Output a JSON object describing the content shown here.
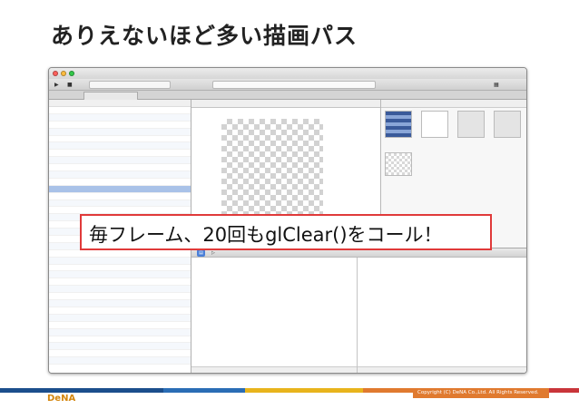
{
  "slide": {
    "title": "ありえないほど多い描画パス",
    "callout": "毎フレーム、20回もglClear()をコール！",
    "brand": "DeNA",
    "copyright": "Copyright (C) DeNA Co.,Ltd. All Rights Reserved."
  },
  "colors": {
    "callout_border": "#e03a3a",
    "footer_segments": [
      "#1b4e8c",
      "#2a6db5",
      "#e8b41c",
      "#e07a2f",
      "#c9353a"
    ]
  }
}
